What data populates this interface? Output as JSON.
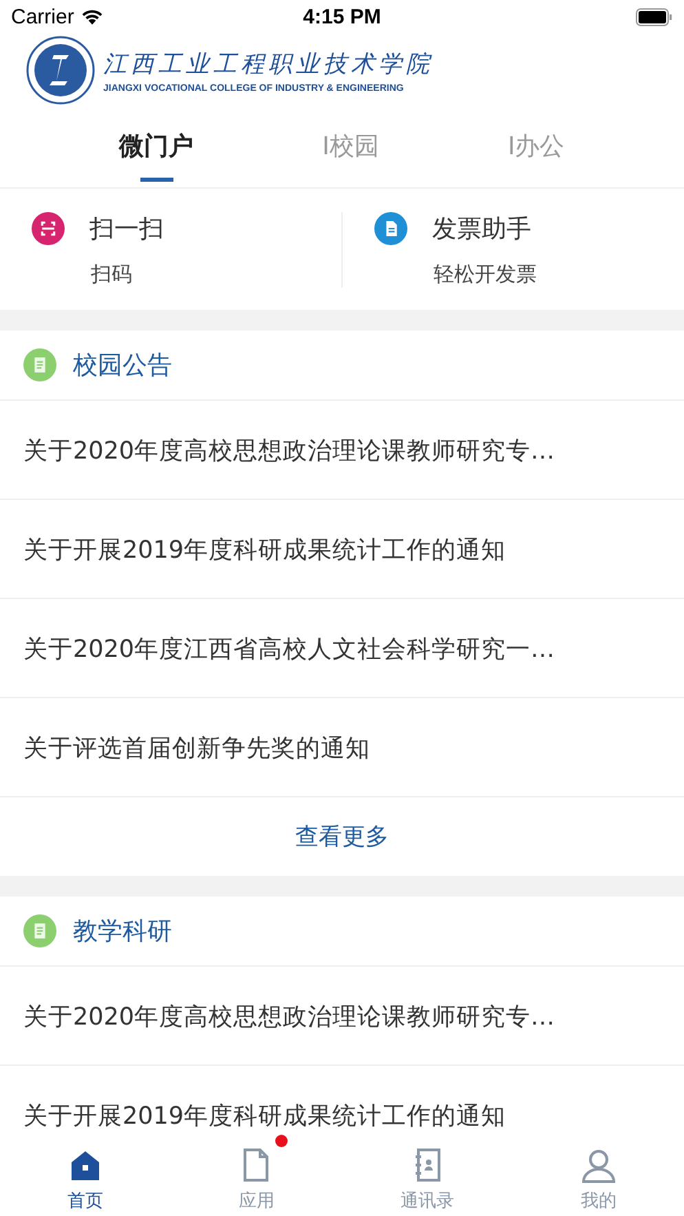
{
  "status_bar": {
    "carrier": "Carrier",
    "time": "4:15 PM"
  },
  "logo": {
    "name": "江西工业工程职业技术学院",
    "subtitle": "JIANGXI VOCATIONAL COLLEGE OF INDUSTRY & ENGINEERING"
  },
  "tabs": [
    {
      "label": "微门户",
      "selected": true
    },
    {
      "label": "I校园",
      "selected": false
    },
    {
      "label": "I办公",
      "selected": false
    }
  ],
  "shortcuts": [
    {
      "kind": "scan",
      "title": "扫一扫",
      "subtitle": "扫码"
    },
    {
      "kind": "invoice",
      "title": "发票助手",
      "subtitle": "轻松开发票"
    }
  ],
  "sections": [
    {
      "title": "校园公告",
      "items": [
        "关于2020年度高校思想政治理论课教师研究专…",
        "关于开展2019年度科研成果统计工作的通知",
        "关于2020年度江西省高校人文社会科学研究一…",
        "关于评选首届创新争先奖的通知"
      ],
      "more": "查看更多"
    },
    {
      "title": "教学科研",
      "items": [
        "关于2020年度高校思想政治理论课教师研究专…",
        "关于开展2019年度科研成果统计工作的通知"
      ]
    }
  ],
  "tab_bar": [
    {
      "kind": "home",
      "label": "首页",
      "selected": true,
      "badge": false
    },
    {
      "kind": "apps",
      "label": "应用",
      "selected": false,
      "badge": true
    },
    {
      "kind": "contacts",
      "label": "通讯录",
      "selected": false,
      "badge": false
    },
    {
      "kind": "profile",
      "label": "我的",
      "selected": false,
      "badge": false
    }
  ]
}
